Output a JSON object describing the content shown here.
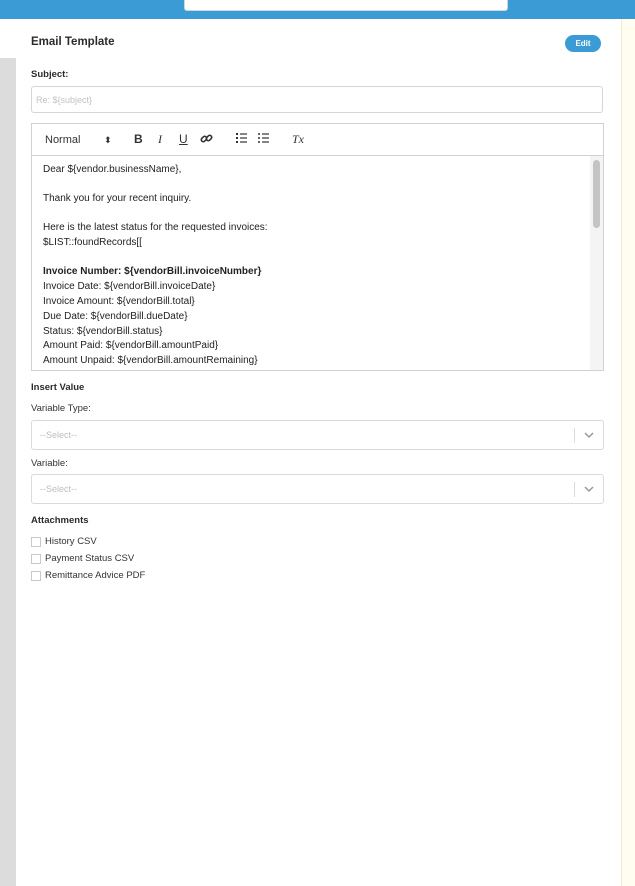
{
  "panel": {
    "title": "Email Template",
    "edit_label": "Edit"
  },
  "subject": {
    "label": "Subject:",
    "placeholder": "Re: ${subject}"
  },
  "editor": {
    "toolbar": {
      "style_select": "Normal",
      "bold": "B",
      "italic": "I",
      "underline": "U",
      "clear_format": "Tx"
    },
    "lines": [
      {
        "text": "Dear ${vendor.businessName},",
        "bold": false
      },
      {
        "text": "Thank you for your recent inquiry.",
        "bold": false
      },
      {
        "text": "Here is the latest status for the requested invoices:",
        "bold": false
      },
      {
        "text": "$LIST::foundRecords[[",
        "bold": false
      },
      {
        "text": "Invoice Number: ${vendorBill.invoiceNumber}",
        "bold": true
      },
      {
        "text": "Invoice Date: ${vendorBill.invoiceDate}",
        "bold": false
      },
      {
        "text": "Invoice Amount: ${vendorBill.total}",
        "bold": false
      },
      {
        "text": "Due Date: ${vendorBill.dueDate}",
        "bold": false
      },
      {
        "text": "Status: ${vendorBill.status}",
        "bold": false
      },
      {
        "text": "Amount Paid: ${vendorBill.amountPaid}",
        "bold": false
      },
      {
        "text": "Amount Unpaid: ${vendorBill.amountRemaining}",
        "bold": false
      }
    ]
  },
  "insert_value": {
    "heading": "Insert Value",
    "variable_type_label": "Variable Type:",
    "variable_type_placeholder": "--Select--",
    "variable_label": "Variable:",
    "variable_placeholder": "--Select--"
  },
  "attachments": {
    "heading": "Attachments",
    "items": [
      {
        "label": "History CSV",
        "checked": false
      },
      {
        "label": "Payment Status CSV",
        "checked": false
      },
      {
        "label": "Remittance Advice PDF",
        "checked": false
      }
    ]
  },
  "colors": {
    "accent": "#3a9bd5",
    "gutter": "#dcdcdc",
    "side_panel": "#fffdf0"
  }
}
